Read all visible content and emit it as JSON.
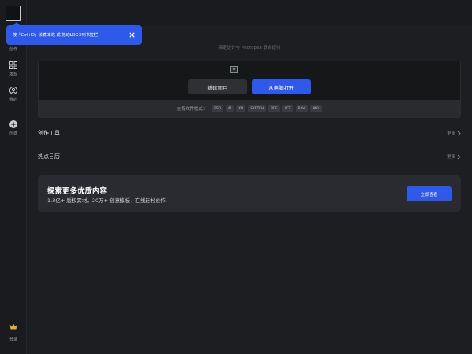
{
  "sidebar": {
    "items": [
      {
        "label": "创作",
        "icon": "create-icon"
      },
      {
        "label": "发现",
        "icon": "discover-icon"
      },
      {
        "label": "我的",
        "icon": "user-icon"
      },
      {
        "label": "创建",
        "icon": "plus-circle-icon"
      }
    ],
    "login": {
      "label": "登录",
      "icon": "crown-icon"
    }
  },
  "tooltip": {
    "text": "按「Ctrl+D」收藏本站 或 拖动LOGO到书签栏"
  },
  "caption": "稿定设计与 Photopea 联合提供",
  "upload": {
    "new_label": "新建项目",
    "open_label": "从电脑打开",
    "formats_label": "支持文件格式：",
    "formats": [
      "PSD",
      "AI",
      "XD",
      "SKETCH",
      "PDF",
      "XCF",
      "RAW",
      "ANY"
    ]
  },
  "sections": [
    {
      "title": "创作工具",
      "more": "更多"
    },
    {
      "title": "热点日历",
      "more": "更多"
    }
  ],
  "promo": {
    "title": "探索更多优质内容",
    "subtitle": "1.3亿+ 版权素材，20万+ 创意模板，在线轻松创作",
    "button": "立即查看"
  },
  "colors": {
    "accent": "#2f59e8",
    "background": "#1d1e22",
    "sidebar": "#1a1b1e",
    "panel": "#161719",
    "promo": "#2a2b30"
  }
}
